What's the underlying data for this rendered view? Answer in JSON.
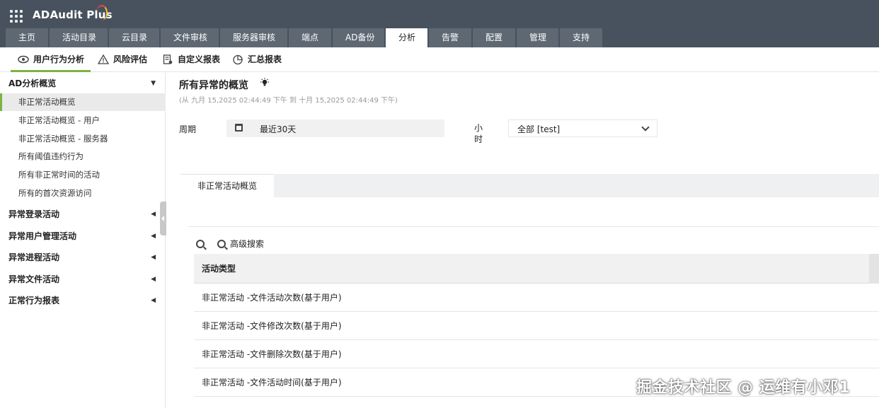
{
  "app": {
    "title": "ADAudit Plus"
  },
  "nav": {
    "tabs": [
      {
        "label": "主页"
      },
      {
        "label": "活动目录"
      },
      {
        "label": "云目录"
      },
      {
        "label": "文件审核"
      },
      {
        "label": "服务器审核"
      },
      {
        "label": "端点"
      },
      {
        "label": "AD备份"
      },
      {
        "label": "分析"
      },
      {
        "label": "告警"
      },
      {
        "label": "配置"
      },
      {
        "label": "管理"
      },
      {
        "label": "支持"
      }
    ],
    "active": "分析"
  },
  "subnav": {
    "items": [
      {
        "label": "用户行为分析",
        "icon": "eye-icon"
      },
      {
        "label": "风险评估",
        "icon": "warning-icon"
      },
      {
        "label": "自定义报表",
        "icon": "custom-report-icon"
      },
      {
        "label": "汇总报表",
        "icon": "pie-chart-icon"
      }
    ],
    "active": "用户行为分析"
  },
  "sidebar": {
    "group_main": "AD分析概览",
    "items": [
      {
        "label": "非正常活动概览"
      },
      {
        "label": "非正常活动概览 - 用户"
      },
      {
        "label": "非正常活动概览 - 服务器"
      },
      {
        "label": "所有阈值违约行为"
      },
      {
        "label": "所有非正常时间的活动"
      },
      {
        "label": "所有的首次资源访问"
      }
    ],
    "groups": [
      {
        "label": "异常登录活动"
      },
      {
        "label": "异常用户管理活动"
      },
      {
        "label": "异常进程活动"
      },
      {
        "label": "异常文件活动"
      },
      {
        "label": "正常行为报表"
      }
    ]
  },
  "main": {
    "title": "所有异常的概览",
    "subtitle": "(从 九月 15,2025 02:44:49 下午 到 十月 15,2025 02:44:49 下午)",
    "period_label": "周期",
    "period_value": "最近30天",
    "hour_label": "小时",
    "select_value": "全部 [test]",
    "tab_label": "非正常活动概览",
    "advanced_search_label": "高级搜索",
    "table": {
      "column_header": "活动类型",
      "rows": [
        "非正常活动 -文件活动次数(基于用户)",
        "非正常活动 -文件修改次数(基于用户)",
        "非正常活动 -文件删除次数(基于用户)",
        "非正常活动 -文件活动时间(基于用户)"
      ]
    }
  },
  "watermark": "掘金技术社区 @ 运维有小邓1",
  "colors": {
    "topbar": "#48525e",
    "tab": "#5e6873",
    "accent": "#7db342"
  }
}
